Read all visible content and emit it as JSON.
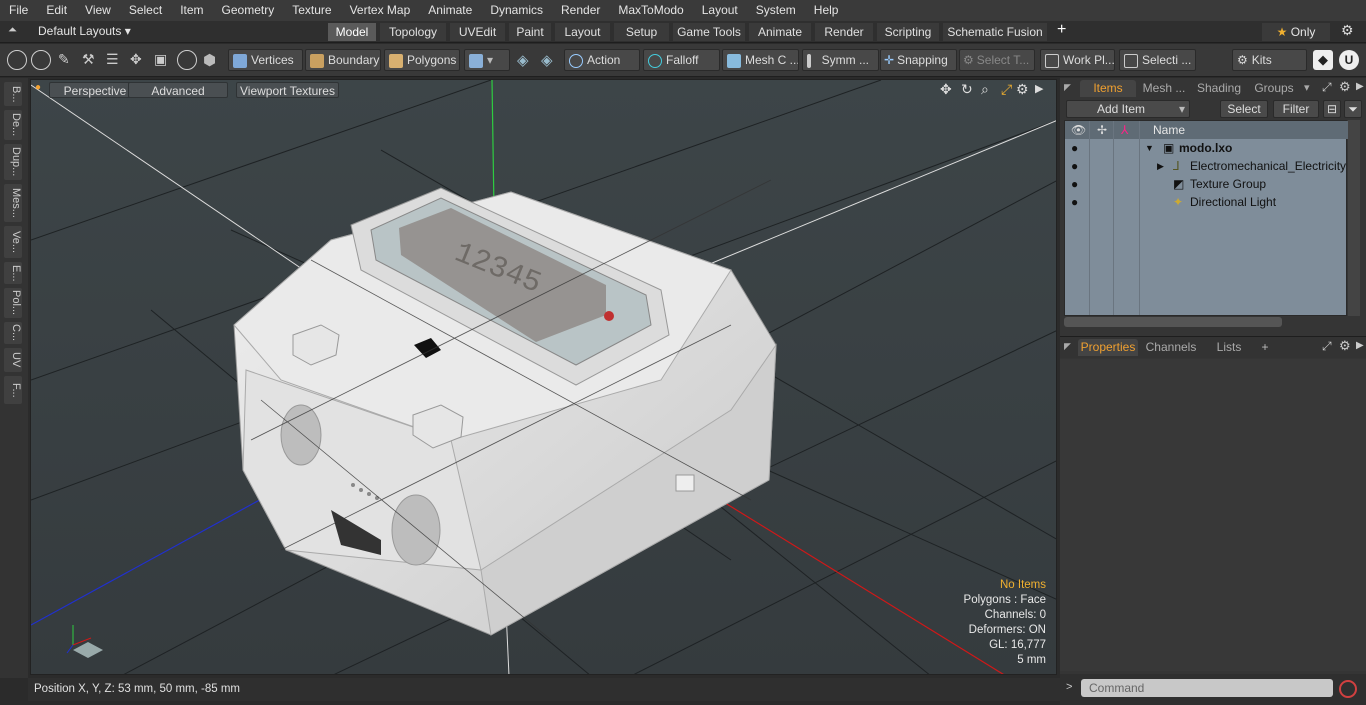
{
  "menu": [
    "File",
    "Edit",
    "View",
    "Select",
    "Item",
    "Geometry",
    "Texture",
    "Vertex Map",
    "Animate",
    "Dynamics",
    "Render",
    "MaxToModo",
    "Layout",
    "System",
    "Help"
  ],
  "layout_selector": "Default Layouts",
  "mode_tabs": [
    "Model",
    "Topology",
    "UVEdit",
    "Paint",
    "Layout",
    "Setup",
    "Game Tools",
    "Animate",
    "Render",
    "Scripting",
    "Schematic Fusion"
  ],
  "active_mode_tab": "Model",
  "only_label": "Only",
  "toolbar": {
    "vertices": "Vertices",
    "boundary": "Boundary",
    "polygons": "Polygons",
    "action": "Action",
    "falloff": "Falloff",
    "mesh": "Mesh C ...",
    "symm": "Symm ...",
    "snapping": "Snapping",
    "select_t": "Select T...",
    "work_pl": "Work Pl...",
    "selecti": "Selecti ...",
    "kits": "Kits"
  },
  "left_tabs": [
    "B...",
    "De...",
    "Dup...",
    "Mes...",
    "Ve...",
    "E...",
    "Pol...",
    "C...",
    "UV",
    "F..."
  ],
  "viewport": {
    "perspective": "Perspective",
    "advanced": "Advanced",
    "viewport_textures": "Viewport Textures",
    "display_digits": "12345",
    "info": {
      "no_items": "No Items",
      "polygons": "Polygons : Face",
      "channels": "Channels: 0",
      "deformers": "Deformers: ON",
      "gl": "GL: 16,777",
      "scale": "5 mm"
    }
  },
  "status": "Position X, Y, Z:   53 mm, 50 mm, -85 mm",
  "items_panel": {
    "tabs": [
      "Items",
      "Mesh ...",
      "Shading",
      "Groups"
    ],
    "add_item": "Add Item",
    "select": "Select",
    "filter": "Filter",
    "name_header": "Name",
    "tree": [
      {
        "label": "modo.lxo",
        "bold": true
      },
      {
        "label": "Electromechanical_Electricity ..."
      },
      {
        "label": "Texture Group"
      },
      {
        "label": "Directional Light"
      }
    ]
  },
  "props_panel": {
    "tabs": [
      "Properties",
      "Channels",
      "Lists"
    ],
    "plus": "+"
  },
  "command_placeholder": "Command",
  "colors": {
    "accent": "#f0a030",
    "viewport_bg": "#3b4346",
    "tree_bg": "#7f8d9a"
  }
}
